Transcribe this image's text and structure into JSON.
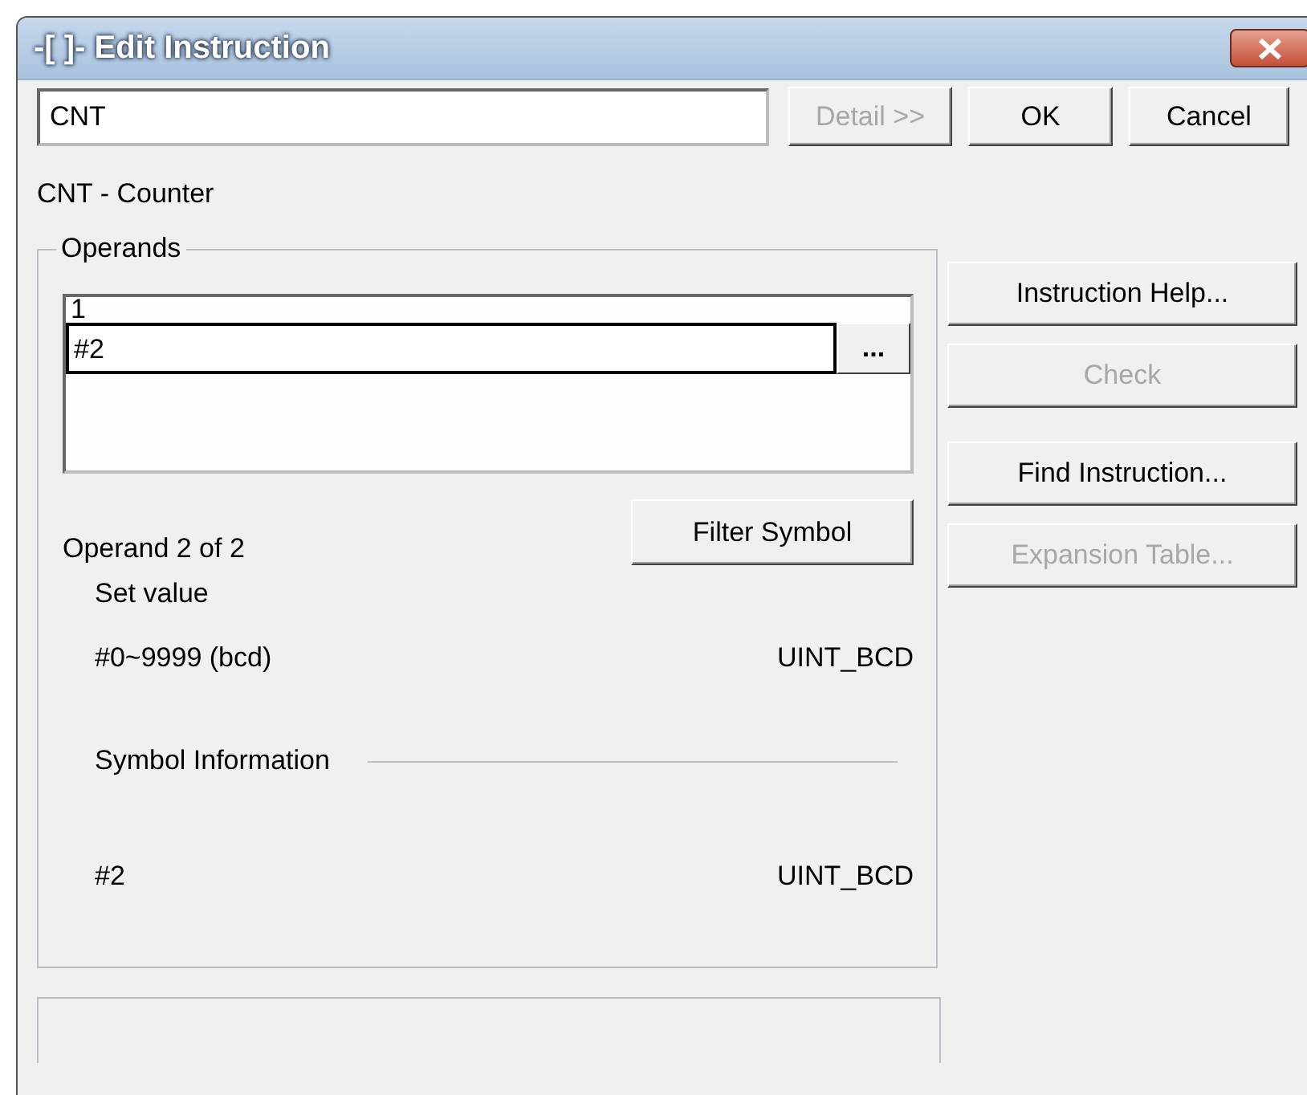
{
  "window": {
    "title": "-[ ]- Edit Instruction"
  },
  "instruction_field": {
    "value": "CNT"
  },
  "top_buttons": [
    {
      "label": "Detail >>",
      "disabled": true
    },
    {
      "label": "OK",
      "disabled": false
    },
    {
      "label": "Cancel",
      "disabled": false
    }
  ],
  "description": "CNT - Counter",
  "operands": {
    "legend": "Operands",
    "items": [
      {
        "value": "1",
        "editing": false
      },
      {
        "value": "#2",
        "editing": true,
        "browse_label": "..."
      }
    ],
    "position": "Operand 2 of 2",
    "filter_button": "Filter Symbol",
    "set_value_label": "Set value",
    "range": "#0~9999 (bcd)",
    "range_type": "UINT_BCD",
    "symbol_heading": "Symbol Information",
    "symbol": "#2",
    "symbol_type": "UINT_BCD"
  },
  "side_buttons": [
    {
      "label": "Instruction Help...",
      "disabled": false
    },
    {
      "label": "Check",
      "disabled": true
    },
    {
      "label": "Find Instruction...",
      "disabled": false
    },
    {
      "label": "Expansion Table...",
      "disabled": true
    }
  ]
}
